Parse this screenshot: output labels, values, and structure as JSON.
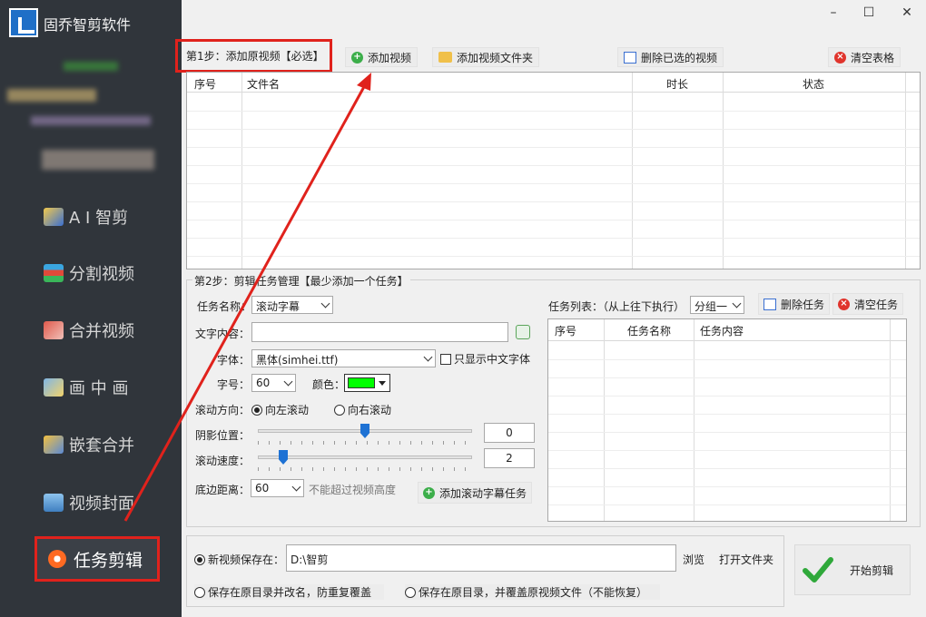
{
  "app": {
    "title": "固乔智剪软件"
  },
  "sidebar": {
    "items": [
      {
        "label": "A I 智剪",
        "icon": "ai-wand-icon",
        "color": "#e8b43a"
      },
      {
        "label": "分割视频",
        "icon": "split-film-icon",
        "color": "#d44a3a"
      },
      {
        "label": "合并视频",
        "icon": "merge-film-icon",
        "color": "#c8564c"
      },
      {
        "label": "画 中 画",
        "icon": "picture-in-picture-icon",
        "color": "#5a9bd6"
      },
      {
        "label": "嵌套合并",
        "icon": "nested-merge-icon",
        "color": "#e0a83a"
      },
      {
        "label": "视频封面",
        "icon": "video-cover-icon",
        "color": "#6aa3d8"
      }
    ],
    "active": {
      "label": "任务剪辑",
      "icon": "task-gear-icon",
      "color": "#ff7a2a"
    }
  },
  "window": {
    "minimize": "–",
    "maximize": "☐",
    "close": "✕"
  },
  "step1": {
    "label": "第1步：添加原视频【必选】",
    "buttons": {
      "add_video": "添加视频",
      "add_folder": "添加视频文件夹",
      "delete_selected": "删除已选的视频",
      "clear_table": "清空表格"
    },
    "columns": [
      "序号",
      "文件名",
      "时长",
      "状态"
    ]
  },
  "step2": {
    "title": "第2步：剪辑任务管理【最少添加一个任务】",
    "task_name_label": "任务名称：",
    "task_name_value": "滚动字幕",
    "text_content_label": "文字内容：",
    "text_content_value": "",
    "font_label": "字体：",
    "font_value": "黑体(simhei.ttf)",
    "only_chinese_label": "只显示中文字体",
    "size_label": "字号：",
    "size_value": "60",
    "color_label": "颜色：",
    "color_value": "#00ff00",
    "direction_label": "滚动方向：",
    "direction_left": "向左滚动",
    "direction_right": "向右滚动",
    "shadow_label": "阴影位置：",
    "shadow_value": "0",
    "speed_label": "滚动速度：",
    "speed_value": "2",
    "bottom_label": "底边距离：",
    "bottom_value": "60",
    "bottom_hint": "不能超过视频高度",
    "add_task_button": "添加滚动字幕任务"
  },
  "tasklist": {
    "label": "任务列表：（从上往下执行）",
    "group_value": "分组一",
    "delete_task": "删除任务",
    "clear_task": "清空任务",
    "columns": [
      "序号",
      "任务名称",
      "任务内容"
    ]
  },
  "output": {
    "save_new_label": "新视频保存在：",
    "save_path": "D:\\智剪",
    "browse": "浏览",
    "open_folder": "打开文件夹",
    "save_rename": "保存在原目录并改名，防重复覆盖",
    "save_overwrite": "保存在原目录，并覆盖原视频文件（不能恢复）",
    "start": "开始剪辑"
  }
}
